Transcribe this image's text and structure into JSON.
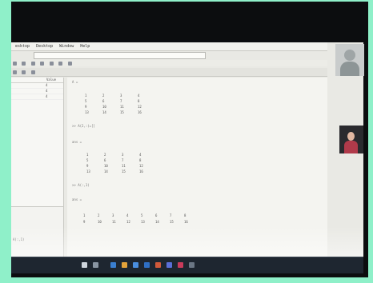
{
  "menubar": {
    "items": [
      "esktop",
      "Desktop",
      "Window",
      "Help"
    ]
  },
  "workspace": {
    "col_value": "Value",
    "rows": [
      {
        "value": "4"
      },
      {
        "value": "4"
      },
      {
        "value": "4"
      }
    ]
  },
  "command_window": {
    "prompt_a": "A =",
    "matrix_a": [
      [
        "1",
        "2",
        "3",
        "4"
      ],
      [
        "5",
        "6",
        "7",
        "8"
      ],
      [
        "9",
        "10",
        "11",
        "12"
      ],
      [
        "13",
        "14",
        "15",
        "16"
      ]
    ],
    "cmd_2": ">> A(2,:)=[]",
    "ans_1": "ans =",
    "matrix_b": [
      [
        "1",
        "2",
        "3",
        "4"
      ],
      [
        "5",
        "6",
        "7",
        "8"
      ],
      [
        "9",
        "10",
        "11",
        "12"
      ],
      [
        "13",
        "14",
        "15",
        "16"
      ]
    ],
    "cmd_3": ">> A(:,1)",
    "ans_2": "ans =",
    "matrix_c": [
      [
        "1",
        "2",
        "3",
        "4",
        "5",
        "6",
        "7",
        "8"
      ],
      [
        "9",
        "10",
        "11",
        "12",
        "13",
        "14",
        "15",
        "16"
      ]
    ]
  },
  "history": {
    "line": "A(:,1)"
  },
  "colors": {
    "screen": "#e9e9e4",
    "taskbar": "#1e2630",
    "background": "#8ff0c9"
  }
}
